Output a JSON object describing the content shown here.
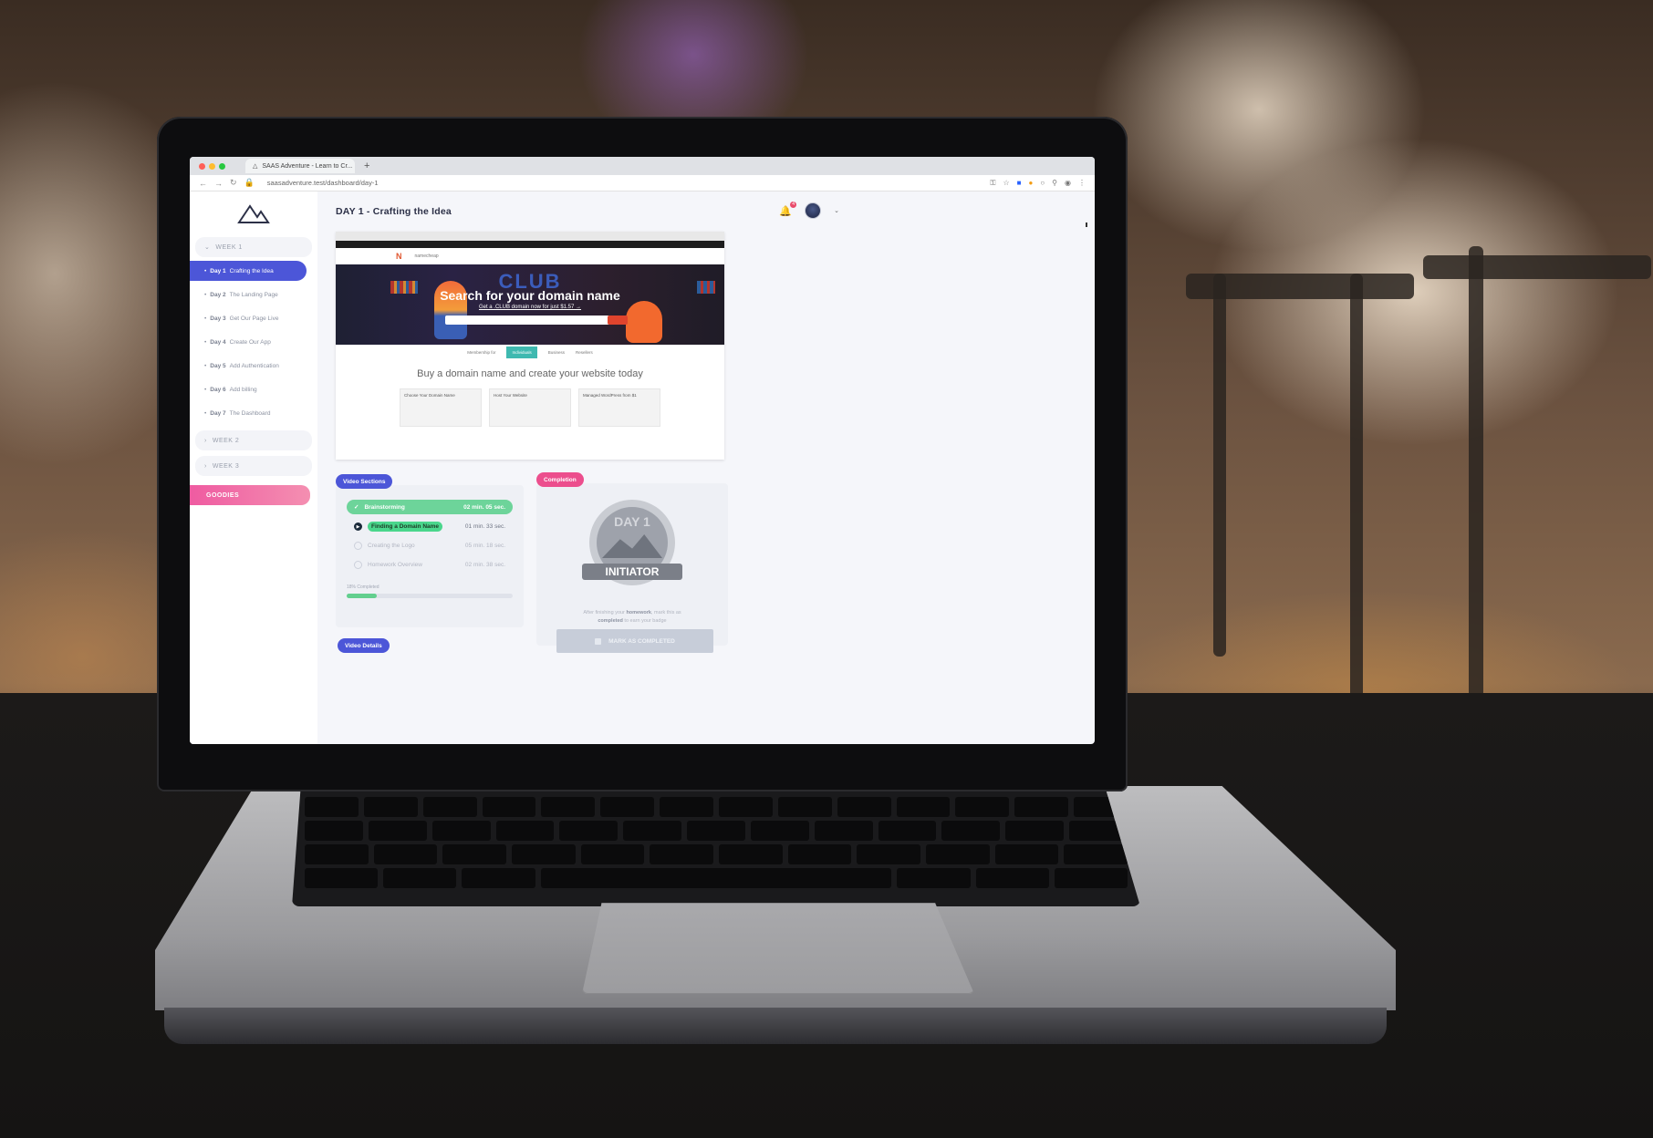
{
  "browser": {
    "tab_title": "SAAS Adventure - Learn to Cr...",
    "tab_close": "×",
    "new_tab": "+",
    "url": "saasadventure.test/dashboard/day-1"
  },
  "sidebar": {
    "weeks": [
      {
        "label": "WEEK 1"
      },
      {
        "label": "WEEK 2"
      },
      {
        "label": "WEEK 3"
      }
    ],
    "days": [
      {
        "num": "Day 1",
        "label": "Crafting the Idea",
        "active": true
      },
      {
        "num": "Day 2",
        "label": "The Landing Page"
      },
      {
        "num": "Day 3",
        "label": "Get Our Page Live"
      },
      {
        "num": "Day 4",
        "label": "Create Our App"
      },
      {
        "num": "Day 5",
        "label": "Add Authentication"
      },
      {
        "num": "Day 6",
        "label": "Add billing"
      },
      {
        "num": "Day 7",
        "label": "The Dashboard"
      }
    ],
    "goodies": "GOODIES"
  },
  "header": {
    "title": "DAY 1 - Crafting the Idea",
    "notification_count": "4"
  },
  "video": {
    "logo_text": "namecheap",
    "club": "CLUB",
    "hero_title": "Search for your domain name",
    "hero_sub": "Get a .CLUB domain now for just $1.57 →",
    "tabs": [
      "Membership for",
      "Individuals",
      "Business",
      "Resellers"
    ],
    "tagline": "Buy a domain name and create your website today",
    "cards": [
      {
        "title": "Choose Your Domain Name"
      },
      {
        "title": "Host Your Website"
      },
      {
        "title": "Managed WordPress from $1"
      }
    ]
  },
  "sections": {
    "label": "Video Sections",
    "lessons": [
      {
        "name": "Brainstorming",
        "time": "02 min. 05 sec.",
        "state": "done"
      },
      {
        "name": "Finding a Domain Name",
        "time": "01 min. 33 sec.",
        "state": "current"
      },
      {
        "name": "Creating the Logo",
        "time": "05 min. 18 sec.",
        "state": "todo"
      },
      {
        "name": "Homework Overview",
        "time": "02 min. 38 sec.",
        "state": "todo"
      }
    ],
    "progress_label": "18% Completed",
    "progress": 0.18
  },
  "completion": {
    "label": "Completion",
    "badge_day": "DAY 1",
    "badge_title": "INITIATOR",
    "text_1": "After finishing your",
    "text_homework": "homework",
    "text_2": ", mark this as",
    "text_completed": "completed",
    "text_3": "to earn your badge",
    "button": "MARK AS COMPLETED"
  },
  "details": {
    "label": "Video Details"
  },
  "colors": {
    "primary": "#4c56d8",
    "pink": "#ec4e8d",
    "green": "#6dd49a"
  }
}
